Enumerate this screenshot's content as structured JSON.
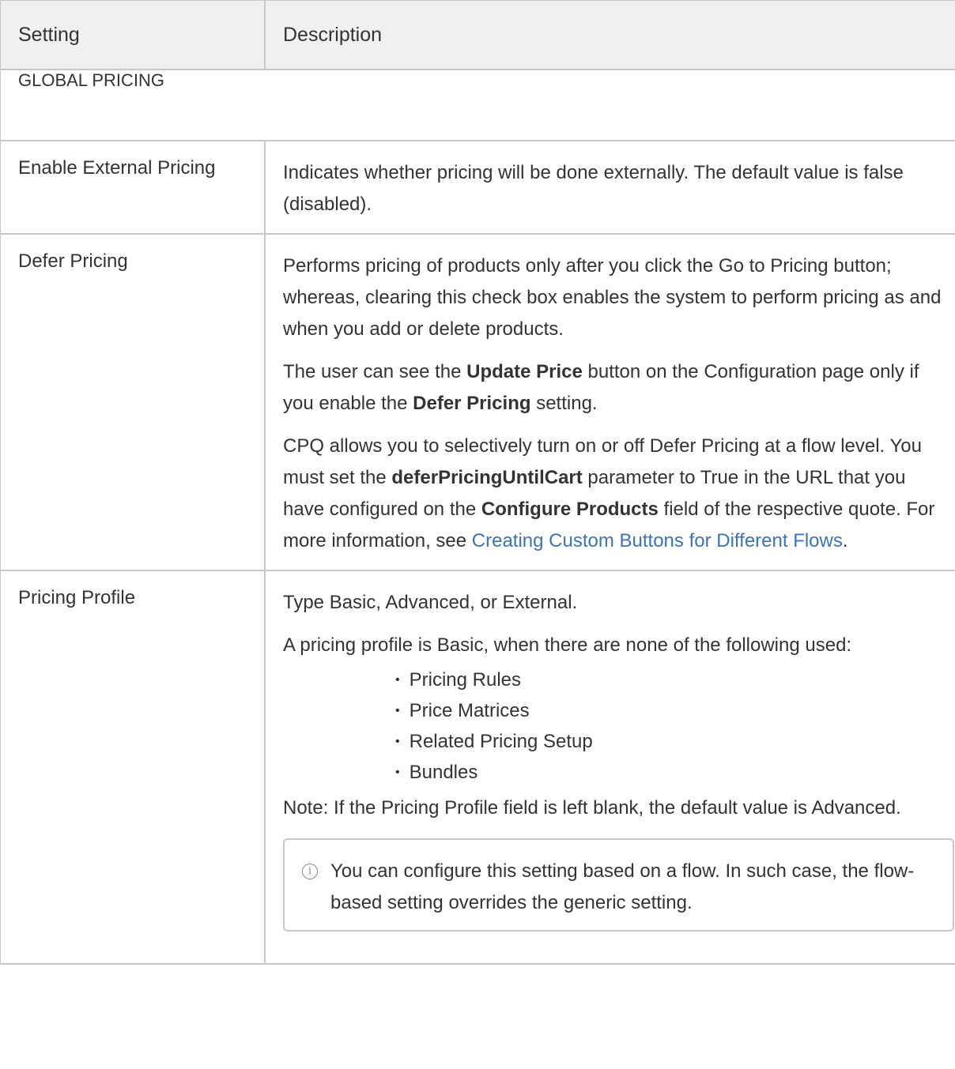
{
  "table": {
    "headers": {
      "setting": "Setting",
      "description": "Description"
    },
    "section_title": "GLOBAL PRICING",
    "rows": [
      {
        "setting": "Enable External Pricing",
        "desc": "Indicates whether pricing will be done externally. The default value is false (disabled)."
      },
      {
        "setting": "Defer Pricing",
        "p1": "Performs pricing of products only after you click the Go to Pricing button; whereas, clearing this check box enables the system to perform pricing as and when you add or delete products.",
        "p2_a": "The user can see the ",
        "p2_b": "Update Price",
        "p2_c": " button on the Configuration page only if you enable the ",
        "p2_d": "Defer Pricing",
        "p2_e": " setting.",
        "p3_a": "CPQ allows you to selectively turn on or off Defer Pricing at a flow level. You must set the ",
        "p3_b": "deferPricingUntilCart",
        "p3_c": " parameter to True in the URL that you have configured on the ",
        "p3_d": "Configure Products",
        "p3_e": " field of the respective quote. For more information, see ",
        "p3_link": "Creating Custom Buttons for Different Flows",
        "p3_f": "."
      },
      {
        "setting": "Pricing Profile",
        "p1": "Type Basic, Advanced, or External.",
        "p2": "A pricing profile is Basic, when there are none of the following used:",
        "list": [
          "Pricing Rules",
          "Price Matrices",
          "Related Pricing Setup",
          "Bundles"
        ],
        "note": "Note: If the Pricing Profile field is left blank, the default value is Advanced.",
        "info": "You can configure this setting based on a flow. In such case, the flow-based setting overrides the generic setting.",
        "info_icon": "info-circle-icon"
      }
    ]
  }
}
